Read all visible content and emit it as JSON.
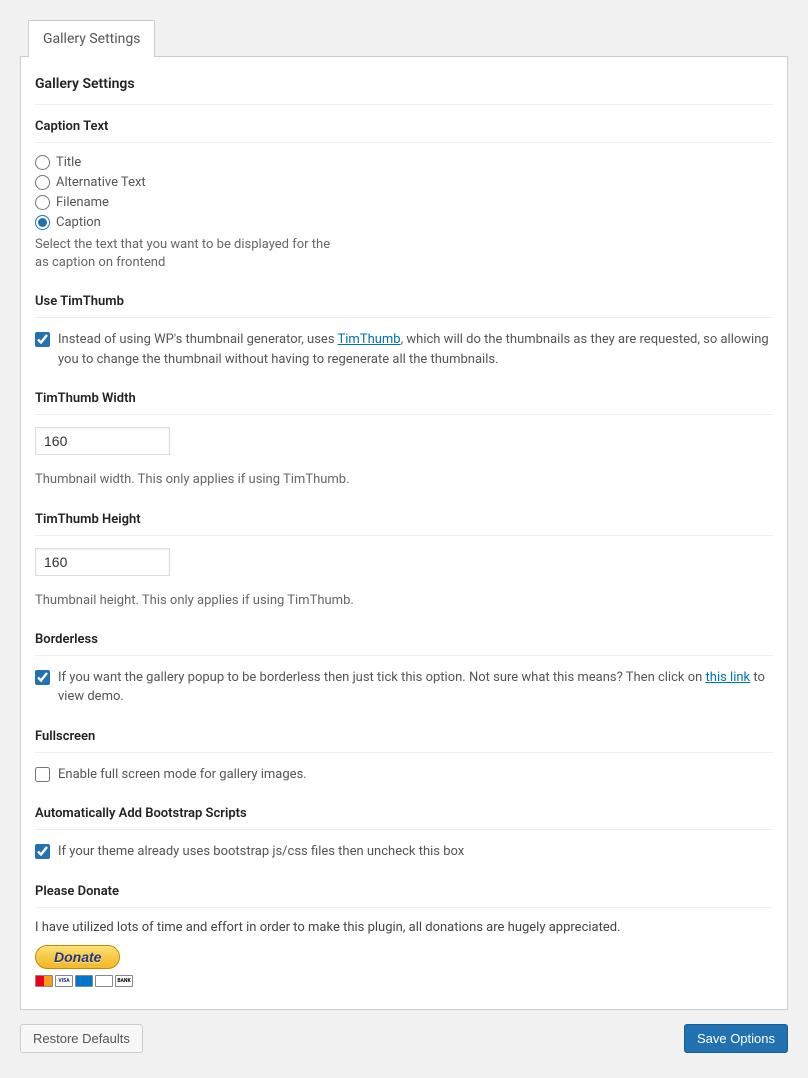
{
  "tab": {
    "label": "Gallery Settings"
  },
  "panel": {
    "title": "Gallery Settings"
  },
  "captionText": {
    "heading": "Caption Text",
    "options": {
      "title": "Title",
      "alt": "Alternative Text",
      "filename": "Filename",
      "caption": "Caption"
    },
    "selected": "caption",
    "desc_line1": "Select the text that you want to be displayed for the",
    "desc_line2": "as caption on frontend"
  },
  "timthumb": {
    "heading": "Use TimThumb",
    "checked": true,
    "label_before": "Instead of using WP's thumbnail generator, uses ",
    "link_text": "TimThumb",
    "label_after": ", which will do the thumbnails as they are requested, so allowing you to change the thumbnail without having to regenerate all the thumbnails."
  },
  "timthumbWidth": {
    "heading": "TimThumb Width",
    "value": "160",
    "desc": "Thumbnail width. This only applies if using TimThumb."
  },
  "timthumbHeight": {
    "heading": "TimThumb Height",
    "value": "160",
    "desc": "Thumbnail height. This only applies if using TimThumb."
  },
  "borderless": {
    "heading": "Borderless",
    "checked": true,
    "label_before": "If you want the gallery popup to be borderless then just tick this option. Not sure what this means? Then click on ",
    "link_text": "this link",
    "label_after": " to view demo."
  },
  "fullscreen": {
    "heading": "Fullscreen",
    "checked": false,
    "label": "Enable full screen mode for gallery images."
  },
  "bootstrap": {
    "heading": "Automatically Add Bootstrap Scripts",
    "checked": true,
    "label": "If your theme already uses bootstrap js/css files then uncheck this box"
  },
  "donate": {
    "heading": "Please Donate",
    "text": "I have utilized lots of time and effort in order to make this plugin, all donations are hugely appreciated.",
    "button": "Donate"
  },
  "footer": {
    "restore": "Restore Defaults",
    "save": "Save Options"
  }
}
